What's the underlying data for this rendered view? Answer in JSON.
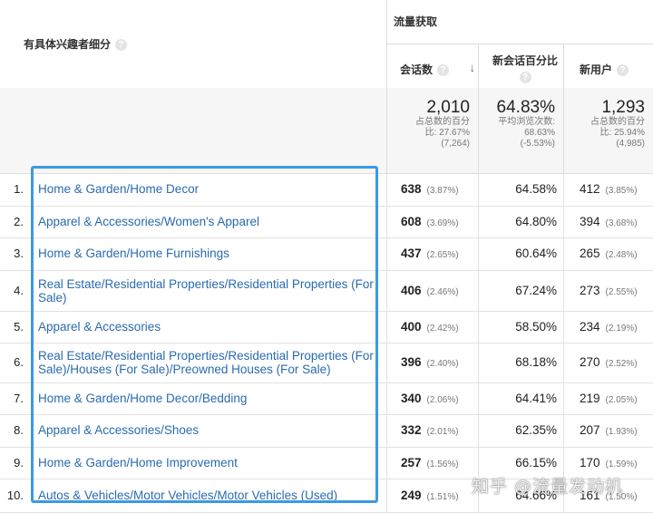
{
  "header": {
    "dimension_label": "有具体兴趣者细分",
    "group_label": "流量获取",
    "columns": {
      "sessions": "会话数",
      "new_session_pct": "新会话百分比",
      "new_users": "新用户"
    }
  },
  "totals": {
    "sessions": {
      "value": "2,010",
      "sub1": "占总数的百分",
      "sub2": "比: 27.67%",
      "sub3": "(7,264)"
    },
    "new_session_pct": {
      "value": "64.83%",
      "sub1": "平均浏览次数:",
      "sub2": "68.63%",
      "sub3": "(-5.53%)"
    },
    "new_users": {
      "value": "1,293",
      "sub1": "占总数的百分",
      "sub2": "比: 25.94%",
      "sub3": "(4,985)"
    }
  },
  "rows": [
    {
      "idx": "1.",
      "label": "Home & Garden/Home Decor",
      "sessions": "638",
      "sessions_pct": "(3.87%)",
      "new_pct": "64.58%",
      "new_users": "412",
      "new_users_pct": "(3.85%)"
    },
    {
      "idx": "2.",
      "label": "Apparel & Accessories/Women's Apparel",
      "sessions": "608",
      "sessions_pct": "(3.69%)",
      "new_pct": "64.80%",
      "new_users": "394",
      "new_users_pct": "(3.68%)"
    },
    {
      "idx": "3.",
      "label": "Home & Garden/Home Furnishings",
      "sessions": "437",
      "sessions_pct": "(2.65%)",
      "new_pct": "60.64%",
      "new_users": "265",
      "new_users_pct": "(2.48%)"
    },
    {
      "idx": "4.",
      "label": "Real Estate/Residential Properties/Residential Properties (For Sale)",
      "sessions": "406",
      "sessions_pct": "(2.46%)",
      "new_pct": "67.24%",
      "new_users": "273",
      "new_users_pct": "(2.55%)"
    },
    {
      "idx": "5.",
      "label": "Apparel & Accessories",
      "sessions": "400",
      "sessions_pct": "(2.42%)",
      "new_pct": "58.50%",
      "new_users": "234",
      "new_users_pct": "(2.19%)"
    },
    {
      "idx": "6.",
      "label": "Real Estate/Residential Properties/Residential Properties (For Sale)/Houses (For Sale)/Preowned Houses (For Sale)",
      "sessions": "396",
      "sessions_pct": "(2.40%)",
      "new_pct": "68.18%",
      "new_users": "270",
      "new_users_pct": "(2.52%)"
    },
    {
      "idx": "7.",
      "label": "Home & Garden/Home Decor/Bedding",
      "sessions": "340",
      "sessions_pct": "(2.06%)",
      "new_pct": "64.41%",
      "new_users": "219",
      "new_users_pct": "(2.05%)"
    },
    {
      "idx": "8.",
      "label": "Apparel & Accessories/Shoes",
      "sessions": "332",
      "sessions_pct": "(2.01%)",
      "new_pct": "62.35%",
      "new_users": "207",
      "new_users_pct": "(1.93%)"
    },
    {
      "idx": "9.",
      "label": "Home & Garden/Home Improvement",
      "sessions": "257",
      "sessions_pct": "(1.56%)",
      "new_pct": "66.15%",
      "new_users": "170",
      "new_users_pct": "(1.59%)"
    },
    {
      "idx": "10.",
      "label": "Autos & Vehicles/Motor Vehicles/Motor Vehicles (Used)",
      "sessions": "249",
      "sessions_pct": "(1.51%)",
      "new_pct": "64.66%",
      "new_users": "161",
      "new_users_pct": "(1.50%)"
    }
  ],
  "watermark": "知乎 @流量发动机",
  "colors": {
    "link": "#2a6bb0",
    "highlight": "#3b9ae4",
    "totals_bg": "#f6f6f6"
  }
}
